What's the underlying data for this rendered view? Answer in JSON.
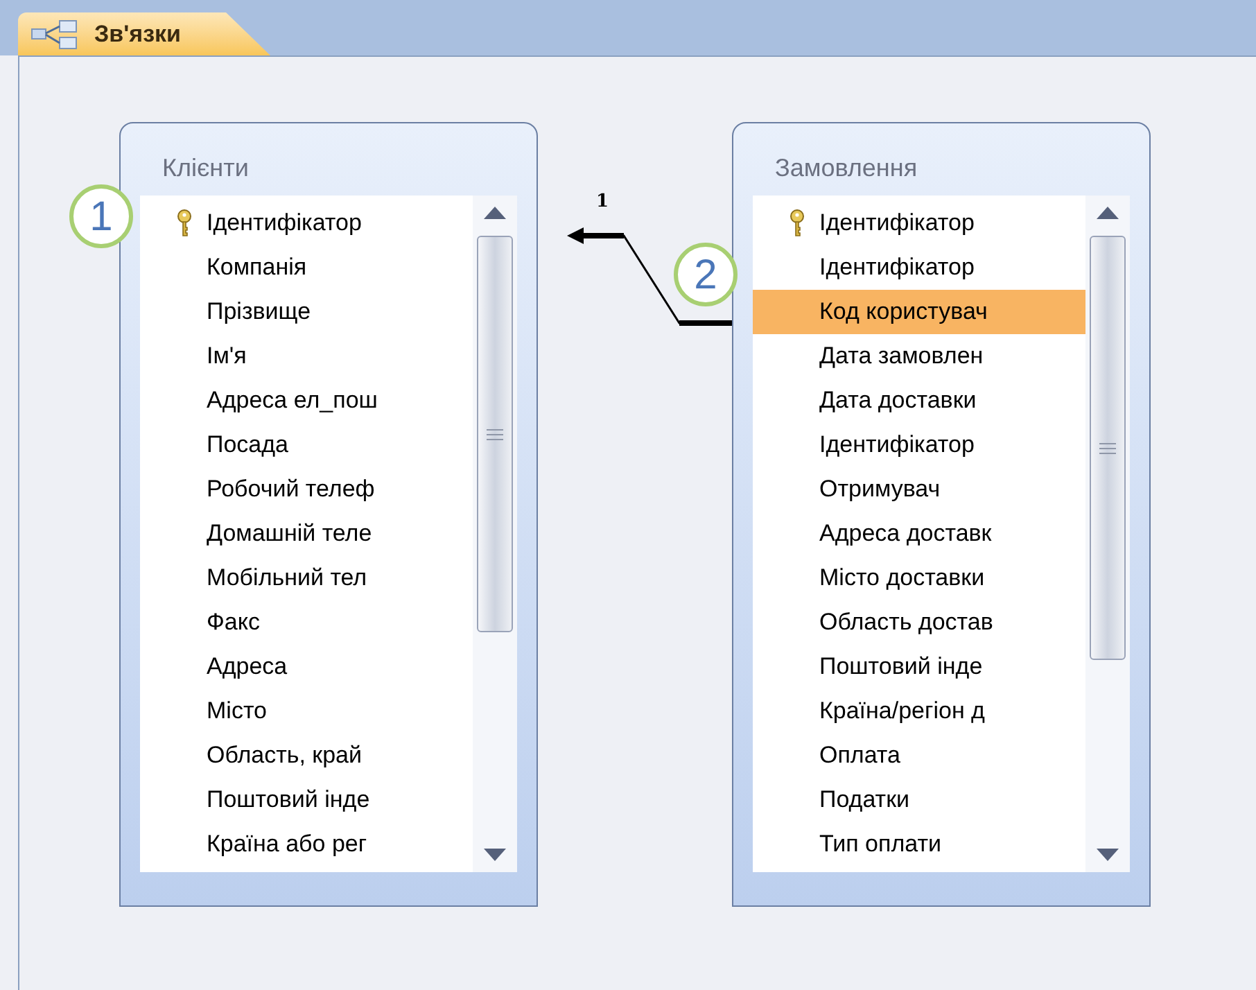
{
  "tabs": [
    {
      "label": "Зв'язки",
      "selected": true
    }
  ],
  "tables": [
    {
      "title": "Клієнти",
      "fields": [
        {
          "name": "Ідентифікатор",
          "key": true,
          "selected": false
        },
        {
          "name": "Компанія",
          "key": false,
          "selected": false
        },
        {
          "name": "Прізвище",
          "key": false,
          "selected": false
        },
        {
          "name": "Ім'я",
          "key": false,
          "selected": false
        },
        {
          "name": "Адреса ел_пош",
          "key": false,
          "selected": false
        },
        {
          "name": "Посада",
          "key": false,
          "selected": false
        },
        {
          "name": "Робочий телеф",
          "key": false,
          "selected": false
        },
        {
          "name": "Домашній теле",
          "key": false,
          "selected": false
        },
        {
          "name": "Мобільний тел",
          "key": false,
          "selected": false
        },
        {
          "name": "Факс",
          "key": false,
          "selected": false
        },
        {
          "name": "Адреса",
          "key": false,
          "selected": false
        },
        {
          "name": "Місто",
          "key": false,
          "selected": false
        },
        {
          "name": "Область, край",
          "key": false,
          "selected": false
        },
        {
          "name": "Поштовий інде",
          "key": false,
          "selected": false
        },
        {
          "name": "Країна або рег",
          "key": false,
          "selected": false
        }
      ]
    },
    {
      "title": "Замовлення",
      "fields": [
        {
          "name": "Ідентифікатор",
          "key": true,
          "selected": false
        },
        {
          "name": "Ідентифікатор",
          "key": false,
          "selected": false
        },
        {
          "name": "Код користувач",
          "key": false,
          "selected": true
        },
        {
          "name": "Дата замовлен",
          "key": false,
          "selected": false
        },
        {
          "name": "Дата доставки",
          "key": false,
          "selected": false
        },
        {
          "name": "Ідентифікатор",
          "key": false,
          "selected": false
        },
        {
          "name": "Отримувач",
          "key": false,
          "selected": false
        },
        {
          "name": "Адреса доставк",
          "key": false,
          "selected": false
        },
        {
          "name": "Місто доставки",
          "key": false,
          "selected": false
        },
        {
          "name": "Область достав",
          "key": false,
          "selected": false
        },
        {
          "name": "Поштовий інде",
          "key": false,
          "selected": false
        },
        {
          "name": "Країна/регіон д",
          "key": false,
          "selected": false
        },
        {
          "name": "Оплата",
          "key": false,
          "selected": false
        },
        {
          "name": "Податки",
          "key": false,
          "selected": false
        },
        {
          "name": "Тип оплати",
          "key": false,
          "selected": false
        }
      ]
    }
  ],
  "relationship": {
    "label": "1"
  },
  "callouts": [
    "1",
    "2"
  ]
}
